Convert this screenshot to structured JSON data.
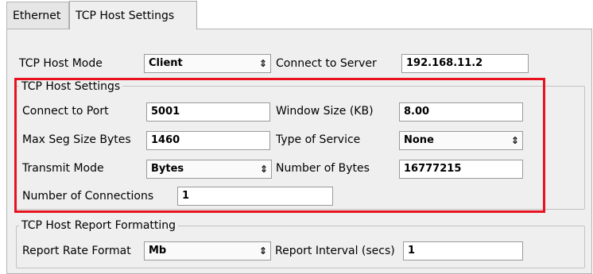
{
  "tabs": [
    {
      "label": "Ethernet"
    },
    {
      "label": "TCP Host Settings",
      "active": true
    }
  ],
  "top": {
    "mode_label": "TCP Host Mode",
    "mode_value": "Client",
    "server_label": "Connect to Server",
    "server_value": "192.168.11.2"
  },
  "settings": {
    "title": "TCP Host Settings",
    "port_label": "Connect to Port",
    "port_value": "5001",
    "window_label": "Window Size (KB)",
    "window_value": "8.00",
    "mss_label": "Max Seg Size Bytes",
    "mss_value": "1460",
    "tos_label": "Type of Service",
    "tos_value": "None",
    "tx_label": "Transmit Mode",
    "tx_value": "Bytes",
    "bytes_label": "Number of Bytes",
    "bytes_value": "16777215",
    "conn_label": "Number of Connections",
    "conn_value": "1"
  },
  "report": {
    "title": "TCP Host Report Formatting",
    "rate_label": "Report Rate Format",
    "rate_value": "Mb",
    "interval_label": "Report Interval (secs)",
    "interval_value": "1"
  },
  "colors": {
    "highlight": "#e8121f",
    "panel": "#efefef"
  },
  "icons": {
    "combo_arrow": "updown-arrow-icon"
  }
}
